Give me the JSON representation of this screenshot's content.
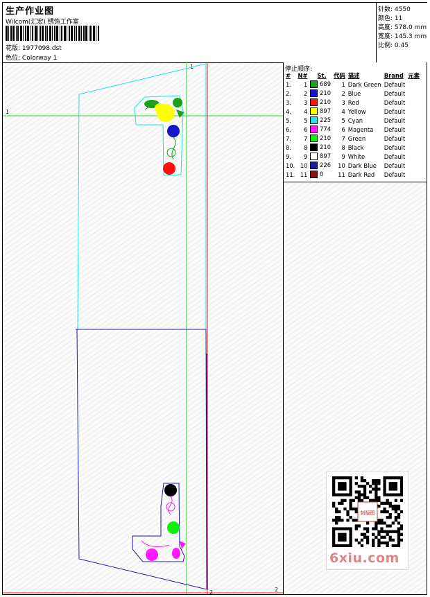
{
  "header": {
    "title": "生产作业图",
    "company": "Wilcom(汇宏) 绣饰工作室",
    "design_label": "花版:",
    "design_value": "1977098.dst",
    "colorway_label": "色位:",
    "colorway_value": "Colorway 1"
  },
  "stats": {
    "stitches_label": "针数:",
    "stitches_value": "4550",
    "colors_label": "颜色:",
    "colors_value": "11",
    "height_label": "高度:",
    "height_value": "578.0 mm",
    "width_label": "宽度:",
    "width_value": "145.3 mm",
    "scale_label": "比例:",
    "scale_value": "0.45"
  },
  "legend": {
    "title": "停止顺序:",
    "headers": [
      "#",
      "N#",
      "St.",
      "代码",
      "描述",
      "Brand",
      "元素"
    ],
    "rows": [
      {
        "idx": "1.",
        "n": "1",
        "color": "#1aa01a",
        "st": "689",
        "code": "1",
        "desc": "Dark Green",
        "brand": "Default"
      },
      {
        "idx": "2.",
        "n": "2",
        "color": "#1515c8",
        "st": "210",
        "code": "2",
        "desc": "Blue",
        "brand": "Default"
      },
      {
        "idx": "3.",
        "n": "3",
        "color": "#ff1010",
        "st": "210",
        "code": "3",
        "desc": "Red",
        "brand": "Default"
      },
      {
        "idx": "4.",
        "n": "4",
        "color": "#ffff00",
        "st": "897",
        "code": "4",
        "desc": "Yellow",
        "brand": "Default"
      },
      {
        "idx": "5.",
        "n": "5",
        "color": "#22e6e6",
        "st": "225",
        "code": "5",
        "desc": "Cyan",
        "brand": "Default"
      },
      {
        "idx": "6.",
        "n": "6",
        "color": "#ff1aff",
        "st": "774",
        "code": "6",
        "desc": "Magenta",
        "brand": "Default"
      },
      {
        "idx": "7.",
        "n": "7",
        "color": "#10ee10",
        "st": "210",
        "code": "7",
        "desc": "Green",
        "brand": "Default"
      },
      {
        "idx": "8.",
        "n": "8",
        "color": "#000000",
        "st": "210",
        "code": "8",
        "desc": "Black",
        "brand": "Default"
      },
      {
        "idx": "9.",
        "n": "9",
        "color": "#ffffff",
        "st": "897",
        "code": "9",
        "desc": "White",
        "brand": "Default"
      },
      {
        "idx": "10.",
        "n": "10",
        "color": "#1c1c9a",
        "st": "226",
        "code": "10",
        "desc": "Dark Blue",
        "brand": "Default"
      },
      {
        "idx": "11.",
        "n": "11",
        "color": "#8b1010",
        "st": "0",
        "code": "11",
        "desc": "Dark Red",
        "brand": "Default"
      }
    ]
  },
  "canvas": {
    "axis_labels": {
      "v_top": "1",
      "h_left": "1",
      "bottom_mid": "2",
      "bottom_right": "2"
    },
    "colors": {
      "green_guide": "#22dd22",
      "red_guide": "#ee1c1c",
      "cyan_outline": "#20e0e0",
      "blue_outline": "#1818a8"
    }
  },
  "qr": {
    "badge_text": "刻版图"
  },
  "watermark": "6xiu.com"
}
